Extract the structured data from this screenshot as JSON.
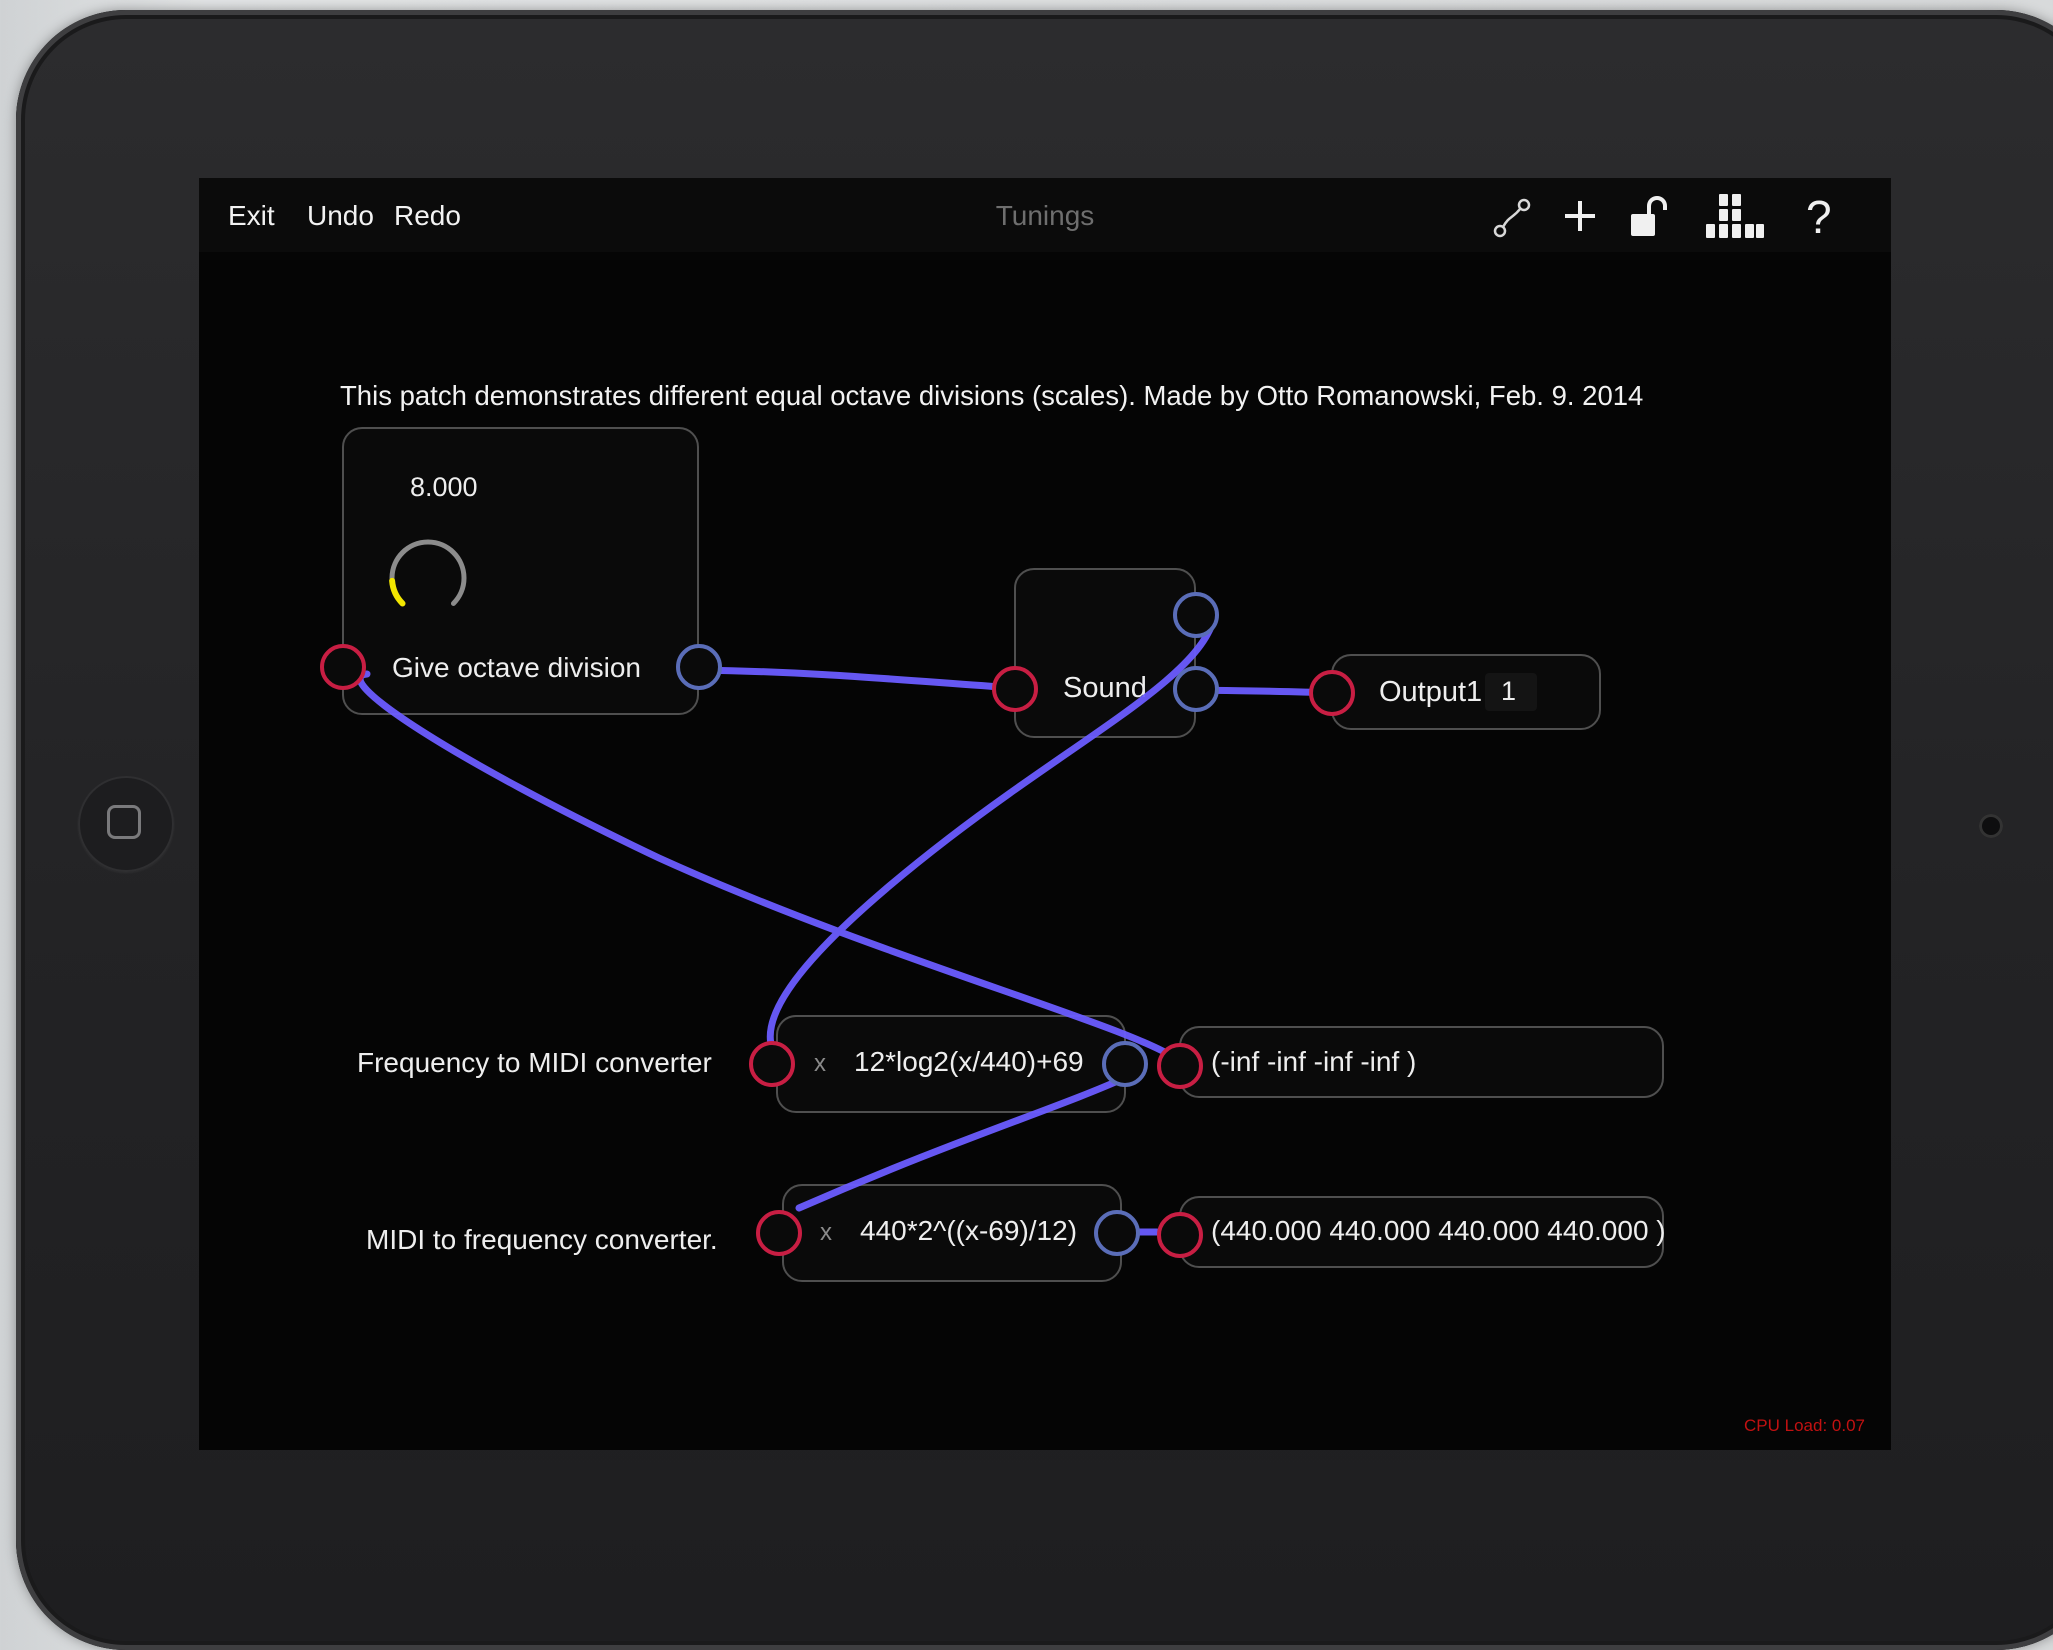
{
  "toolbar": {
    "exit_label": "Exit",
    "undo_label": "Undo",
    "redo_label": "Redo",
    "title": "Tunings",
    "icons": [
      "wire-connect-icon",
      "plus-icon",
      "unlock-icon",
      "palette-blocks-icon",
      "help-icon"
    ],
    "help_label": "?"
  },
  "patch": {
    "comment": "This patch demonstrates different equal octave divisions (scales). Made by Otto Romanowski, Feb. 9. 2014",
    "knob_module": {
      "value": "8.000",
      "label": "Give octave division",
      "knob_fill_fraction": 0.15
    },
    "sound_module": {
      "label": "Sound"
    },
    "output_module": {
      "label": "Output1",
      "channel": "1"
    },
    "freq_to_midi": {
      "title": "Frequency to MIDI converter",
      "operator": "x",
      "expression": "12*log2(x/440)+69",
      "result": "(-inf -inf -inf -inf )"
    },
    "midi_to_freq": {
      "title": "MIDI to frequency converter.",
      "operator": "x",
      "expression": "440*2^((x-69)/12)",
      "result": "(440.000 440.000 440.000 440.000 )"
    }
  },
  "status": {
    "cpu_load": "CPU Load: 0.07"
  },
  "colors": {
    "wire": "#6b5cff",
    "inlet": "#c81e43",
    "outlet": "#5a6db8",
    "knob_arc": "#f2e600",
    "cpu_text": "#c21111"
  }
}
